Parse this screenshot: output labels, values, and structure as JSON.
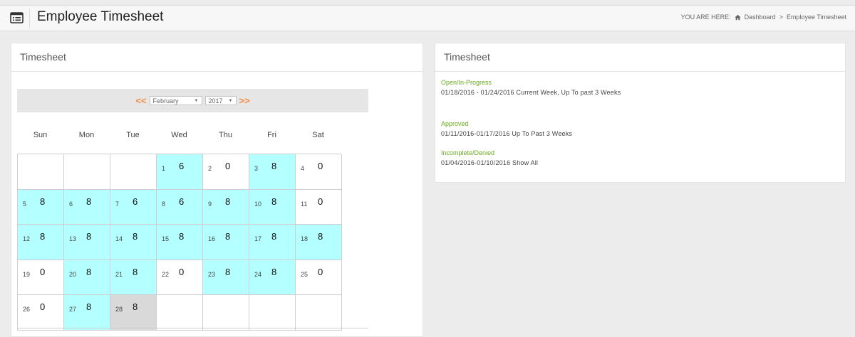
{
  "header": {
    "title": "Employee Timesheet",
    "breadcrumb_prefix": "YOU ARE HERE:",
    "breadcrumb_home": "Dashboard",
    "breadcrumb_sep": ">",
    "breadcrumb_current": "Employee Timesheet",
    "icons": [
      "list-icon",
      "home-icon"
    ]
  },
  "left_panel": {
    "title": "Timesheet",
    "nav": {
      "prev": "<<",
      "next": ">>",
      "month": "February",
      "year": "2017"
    },
    "weekdays": [
      "Sun",
      "Mon",
      "Tue",
      "Wed",
      "Thu",
      "Fri",
      "Sat"
    ],
    "days": [
      {
        "day": "",
        "hours": "",
        "state": "empty"
      },
      {
        "day": "",
        "hours": "",
        "state": "empty"
      },
      {
        "day": "",
        "hours": "",
        "state": "empty"
      },
      {
        "day": "1",
        "hours": "6",
        "state": "filled"
      },
      {
        "day": "2",
        "hours": "0",
        "state": "blank"
      },
      {
        "day": "3",
        "hours": "8",
        "state": "filled"
      },
      {
        "day": "4",
        "hours": "0",
        "state": "blank"
      },
      {
        "day": "5",
        "hours": "8",
        "state": "filled"
      },
      {
        "day": "6",
        "hours": "8",
        "state": "filled"
      },
      {
        "day": "7",
        "hours": "6",
        "state": "filled"
      },
      {
        "day": "8",
        "hours": "6",
        "state": "filled"
      },
      {
        "day": "9",
        "hours": "8",
        "state": "filled"
      },
      {
        "day": "10",
        "hours": "8",
        "state": "filled"
      },
      {
        "day": "11",
        "hours": "0",
        "state": "blank"
      },
      {
        "day": "12",
        "hours": "8",
        "state": "filled"
      },
      {
        "day": "13",
        "hours": "8",
        "state": "filled"
      },
      {
        "day": "14",
        "hours": "8",
        "state": "filled"
      },
      {
        "day": "15",
        "hours": "8",
        "state": "filled"
      },
      {
        "day": "16",
        "hours": "8",
        "state": "filled"
      },
      {
        "day": "17",
        "hours": "8",
        "state": "filled"
      },
      {
        "day": "18",
        "hours": "8",
        "state": "filled"
      },
      {
        "day": "19",
        "hours": "0",
        "state": "blank"
      },
      {
        "day": "20",
        "hours": "8",
        "state": "filled"
      },
      {
        "day": "21",
        "hours": "8",
        "state": "filled"
      },
      {
        "day": "22",
        "hours": "0",
        "state": "blank"
      },
      {
        "day": "23",
        "hours": "8",
        "state": "filled"
      },
      {
        "day": "24",
        "hours": "8",
        "state": "filled"
      },
      {
        "day": "25",
        "hours": "0",
        "state": "blank"
      },
      {
        "day": "26",
        "hours": "0",
        "state": "blank"
      },
      {
        "day": "27",
        "hours": "8",
        "state": "filled"
      },
      {
        "day": "28",
        "hours": "8",
        "state": "today"
      },
      {
        "day": "",
        "hours": "",
        "state": "empty"
      },
      {
        "day": "",
        "hours": "",
        "state": "empty"
      },
      {
        "day": "",
        "hours": "",
        "state": "empty"
      },
      {
        "day": "",
        "hours": "",
        "state": "empty"
      }
    ]
  },
  "right_panel": {
    "title": "Timesheet",
    "sections": [
      {
        "label": "Open/In-Progress",
        "range": "01/18/2016 - 01/24/2016 Current Week, Up To past 3 Weeks"
      },
      {
        "label": "Approved",
        "range": "01/11/2016-01/17/2016 Up To Past 3 Weeks"
      },
      {
        "label": "Incomplete/Denied",
        "range": "01/04/2016-01/10/2016 Show All"
      }
    ]
  },
  "colors": {
    "filled_cell": "#b4ffff",
    "today_cell": "#d9d9d9",
    "nav_arrow": "#f28a3c",
    "status_label": "#6aaa1f"
  }
}
